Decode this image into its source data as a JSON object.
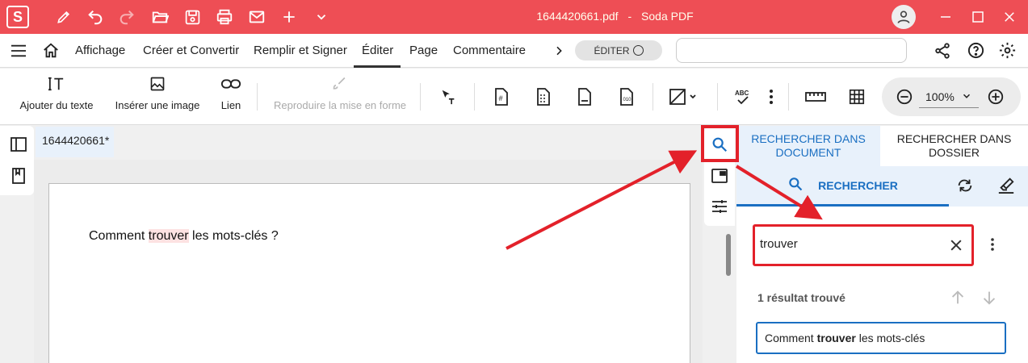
{
  "window": {
    "title": "1644420661.pdf",
    "separator": "-",
    "app_name": "Soda PDF",
    "logo_letter": "S"
  },
  "menu": {
    "items": [
      "Affichage",
      "Créer et Convertir",
      "Remplir et Signer",
      "Éditer",
      "Page",
      "Commentaire"
    ],
    "active": "Éditer",
    "mode_toggle_label": "ÉDITER"
  },
  "toolbar": {
    "add_text": "Ajouter du texte",
    "insert_image": "Insérer une image",
    "link": "Lien",
    "format_painter": "Reproduire la mise en forme",
    "zoom_value": "100%"
  },
  "document": {
    "tab_label": "1644420661*",
    "text_before": "Comment ",
    "text_highlight": "trouver",
    "text_after": " les mots-clés ?"
  },
  "search_panel": {
    "tab_document": "RECHERCHER DANS DOCUMENT",
    "tab_folder": "RECHERCHER DANS DOSSIER",
    "subtab_search": "RECHERCHER",
    "query": "trouver",
    "result_count": "1 résultat trouvé",
    "result_before": "Comment ",
    "result_match": "trouver",
    "result_after": " les mots-clés"
  },
  "colors": {
    "brand": "#ee4e55",
    "accent": "#1a6fc2",
    "annotation": "#e3212a",
    "highlight": "#fde2e2"
  }
}
